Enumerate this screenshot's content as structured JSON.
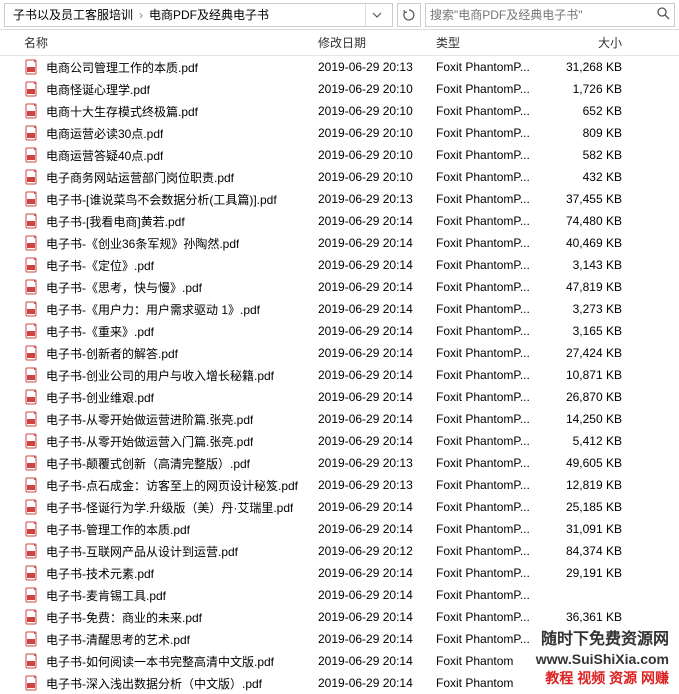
{
  "breadcrumb": {
    "item1": "子书以及员工客服培训",
    "item2": "电商PDF及经典电子书"
  },
  "search": {
    "placeholder": "搜索\"电商PDF及经典电子书\""
  },
  "columns": {
    "name": "名称",
    "date": "修改日期",
    "type": "类型",
    "size": "大小"
  },
  "files": [
    {
      "name": "电商公司管理工作的本质.pdf",
      "date": "2019-06-29 20:13",
      "type": "Foxit PhantomP...",
      "size": "31,268 KB"
    },
    {
      "name": "电商怪诞心理学.pdf",
      "date": "2019-06-29 20:10",
      "type": "Foxit PhantomP...",
      "size": "1,726 KB"
    },
    {
      "name": "电商十大生存模式终极篇.pdf",
      "date": "2019-06-29 20:10",
      "type": "Foxit PhantomP...",
      "size": "652 KB"
    },
    {
      "name": "电商运营必读30点.pdf",
      "date": "2019-06-29 20:10",
      "type": "Foxit PhantomP...",
      "size": "809 KB"
    },
    {
      "name": "电商运营答疑40点.pdf",
      "date": "2019-06-29 20:10",
      "type": "Foxit PhantomP...",
      "size": "582 KB"
    },
    {
      "name": "电子商务网站运营部门岗位职责.pdf",
      "date": "2019-06-29 20:10",
      "type": "Foxit PhantomP...",
      "size": "432 KB"
    },
    {
      "name": "电子书-[谁说菜鸟不会数据分析(工具篇)].pdf",
      "date": "2019-06-29 20:13",
      "type": "Foxit PhantomP...",
      "size": "37,455 KB"
    },
    {
      "name": "电子书-[我看电商]黄若.pdf",
      "date": "2019-06-29 20:14",
      "type": "Foxit PhantomP...",
      "size": "74,480 KB"
    },
    {
      "name": "电子书-《创业36条军规》孙陶然.pdf",
      "date": "2019-06-29 20:14",
      "type": "Foxit PhantomP...",
      "size": "40,469 KB"
    },
    {
      "name": "电子书-《定位》.pdf",
      "date": "2019-06-29 20:14",
      "type": "Foxit PhantomP...",
      "size": "3,143 KB"
    },
    {
      "name": "电子书-《思考，快与慢》.pdf",
      "date": "2019-06-29 20:14",
      "type": "Foxit PhantomP...",
      "size": "47,819 KB"
    },
    {
      "name": "电子书-《用户力：用户需求驱动 1》.pdf",
      "date": "2019-06-29 20:14",
      "type": "Foxit PhantomP...",
      "size": "3,273 KB"
    },
    {
      "name": "电子书-《重来》.pdf",
      "date": "2019-06-29 20:14",
      "type": "Foxit PhantomP...",
      "size": "3,165 KB"
    },
    {
      "name": "电子书-创新者的解答.pdf",
      "date": "2019-06-29 20:14",
      "type": "Foxit PhantomP...",
      "size": "27,424 KB"
    },
    {
      "name": "电子书-创业公司的用户与收入增长秘籍.pdf",
      "date": "2019-06-29 20:14",
      "type": "Foxit PhantomP...",
      "size": "10,871 KB"
    },
    {
      "name": "电子书-创业维艰.pdf",
      "date": "2019-06-29 20:14",
      "type": "Foxit PhantomP...",
      "size": "26,870 KB"
    },
    {
      "name": "电子书-从零开始做运营进阶篇.张亮.pdf",
      "date": "2019-06-29 20:14",
      "type": "Foxit PhantomP...",
      "size": "14,250 KB"
    },
    {
      "name": "电子书-从零开始做运营入门篇.张亮.pdf",
      "date": "2019-06-29 20:14",
      "type": "Foxit PhantomP...",
      "size": "5,412 KB"
    },
    {
      "name": "电子书-颠覆式创新（高清完整版）.pdf",
      "date": "2019-06-29 20:13",
      "type": "Foxit PhantomP...",
      "size": "49,605 KB"
    },
    {
      "name": "电子书-点石成金：访客至上的网页设计秘笈.pdf",
      "date": "2019-06-29 20:13",
      "type": "Foxit PhantomP...",
      "size": "12,819 KB"
    },
    {
      "name": "电子书-怪诞行为学.升级版（美）丹·艾瑞里.pdf",
      "date": "2019-06-29 20:14",
      "type": "Foxit PhantomP...",
      "size": "25,185 KB"
    },
    {
      "name": "电子书-管理工作的本质.pdf",
      "date": "2019-06-29 20:14",
      "type": "Foxit PhantomP...",
      "size": "31,091 KB"
    },
    {
      "name": "电子书-互联网产品从设计到运营.pdf",
      "date": "2019-06-29 20:12",
      "type": "Foxit PhantomP...",
      "size": "84,374 KB"
    },
    {
      "name": "电子书-技术元素.pdf",
      "date": "2019-06-29 20:14",
      "type": "Foxit PhantomP...",
      "size": "29,191 KB"
    },
    {
      "name": "电子书-麦肯锡工具.pdf",
      "date": "2019-06-29 20:14",
      "type": "Foxit PhantomP...",
      "size": ""
    },
    {
      "name": "电子书-免费：商业的未来.pdf",
      "date": "2019-06-29 20:14",
      "type": "Foxit PhantomP...",
      "size": "36,361 KB"
    },
    {
      "name": "电子书-清醒思考的艺术.pdf",
      "date": "2019-06-29 20:14",
      "type": "Foxit PhantomP...",
      "size": ""
    },
    {
      "name": "电子书-如何阅读一本书完整高清中文版.pdf",
      "date": "2019-06-29 20:14",
      "type": "Foxit Phantom",
      "size": ""
    },
    {
      "name": "电子书-深入浅出数据分析（中文版）.pdf",
      "date": "2019-06-29 20:14",
      "type": "Foxit Phantom",
      "size": ""
    }
  ],
  "watermark": {
    "line1": "随时下免费资源网",
    "line2": "www.SuiShiXia.com",
    "line3": "教程 视频 资源 网赚"
  }
}
